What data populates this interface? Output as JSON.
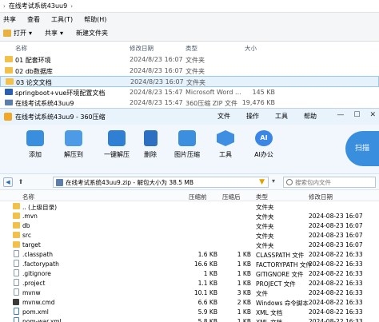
{
  "explorer": {
    "breadcrumb": [
      "在线考试系统43uu9"
    ],
    "menu": [
      "共享",
      "查看",
      "工具(T)",
      "帮助(H)"
    ],
    "toolbar": [
      "打开",
      "共享",
      "新建文件夹"
    ],
    "columns": {
      "name": "名称",
      "date": "修改日期",
      "type": "类型",
      "size": "大小"
    },
    "rows": [
      {
        "name": "01 配套环境",
        "date": "2024/8/23 16:07",
        "type": "文件夹",
        "size": "",
        "kind": "folder"
      },
      {
        "name": "02 db数据库",
        "date": "2024/8/23 16:07",
        "type": "文件夹",
        "size": "",
        "kind": "folder"
      },
      {
        "name": "03 论文文档",
        "date": "2024/8/23 16:07",
        "type": "文件夹",
        "size": "",
        "kind": "folder",
        "highlighted": true
      },
      {
        "name": "springboot+vue环境配置文档",
        "date": "2024/8/23 15:47",
        "type": "Microsoft Word ...",
        "size": "145 KB",
        "kind": "doc"
      },
      {
        "name": "在线考试系统43uu9",
        "date": "2024/8/23 15:47",
        "type": "360压缩 ZIP 文件",
        "size": "19,476 KB",
        "kind": "zip"
      }
    ]
  },
  "zip": {
    "title": "在线考试系统43uu9 - 360压缩",
    "menu": [
      "文件",
      "操作",
      "工具",
      "帮助"
    ],
    "window_controls": [
      "—",
      "☐",
      "✕"
    ],
    "toolbar": [
      {
        "label": "添加",
        "icon": "add-icon"
      },
      {
        "label": "解压到",
        "icon": "extract-to-icon"
      },
      {
        "label": "一键解压",
        "icon": "one-click-extract-icon"
      },
      {
        "label": "删除",
        "icon": "delete-icon"
      },
      {
        "label": "图片压缩",
        "icon": "image-compress-icon"
      },
      {
        "label": "工具",
        "icon": "tools-icon"
      },
      {
        "label": "AI办公",
        "icon": "ai-office-icon"
      }
    ],
    "ai_badge": "AI",
    "scan_label": "扫描",
    "path": "在线考试系统43uu9.zip - 解包大小为 38.5 MB",
    "search_placeholder": "搜索包内文件",
    "columns": {
      "name": "名称",
      "size": "压缩前",
      "csize": "压缩后",
      "type": "类型",
      "modified": "修改日期"
    },
    "rows": [
      {
        "name": ".. (上级目录)",
        "size": "",
        "csize": "",
        "type": "文件夹",
        "modified": "",
        "kind": "folder"
      },
      {
        "name": ".mvn",
        "size": "",
        "csize": "",
        "type": "文件夹",
        "modified": "2024-08-23 16:07",
        "kind": "folder"
      },
      {
        "name": "db",
        "size": "",
        "csize": "",
        "type": "文件夹",
        "modified": "2024-08-23 16:07",
        "kind": "folder"
      },
      {
        "name": "src",
        "size": "",
        "csize": "",
        "type": "文件夹",
        "modified": "2024-08-23 16:07",
        "kind": "folder"
      },
      {
        "name": "target",
        "size": "",
        "csize": "",
        "type": "文件夹",
        "modified": "2024-08-23 16:07",
        "kind": "folder"
      },
      {
        "name": ".classpath",
        "size": "1.6 KB",
        "csize": "1 KB",
        "type": "CLASSPATH 文件",
        "modified": "2024-08-22 16:33",
        "kind": "file"
      },
      {
        "name": ".factorypath",
        "size": "16.6 KB",
        "csize": "1 KB",
        "type": "FACTORYPATH 文件",
        "modified": "2024-08-22 16:33",
        "kind": "file"
      },
      {
        "name": ".gitignore",
        "size": "1 KB",
        "csize": "1 KB",
        "type": "GITIGNORE 文件",
        "modified": "2024-08-22 16:33",
        "kind": "file"
      },
      {
        "name": ".project",
        "size": "1.1 KB",
        "csize": "1 KB",
        "type": "PROJECT 文件",
        "modified": "2024-08-22 16:33",
        "kind": "file"
      },
      {
        "name": "mvnw",
        "size": "10.1 KB",
        "csize": "3 KB",
        "type": "文件",
        "modified": "2024-08-22 16:33",
        "kind": "file"
      },
      {
        "name": "mvnw.cmd",
        "size": "6.6 KB",
        "csize": "2 KB",
        "type": "Windows 命令脚本",
        "modified": "2024-08-22 16:33",
        "kind": "cmd"
      },
      {
        "name": "pom.xml",
        "size": "5.9 KB",
        "csize": "1 KB",
        "type": "XML 文档",
        "modified": "2024-08-22 16:33",
        "kind": "xml"
      },
      {
        "name": "pom-war.xml",
        "size": "5.8 KB",
        "csize": "1 KB",
        "type": "XML 文档",
        "modified": "2024-08-22 16:33",
        "kind": "xml"
      }
    ]
  }
}
